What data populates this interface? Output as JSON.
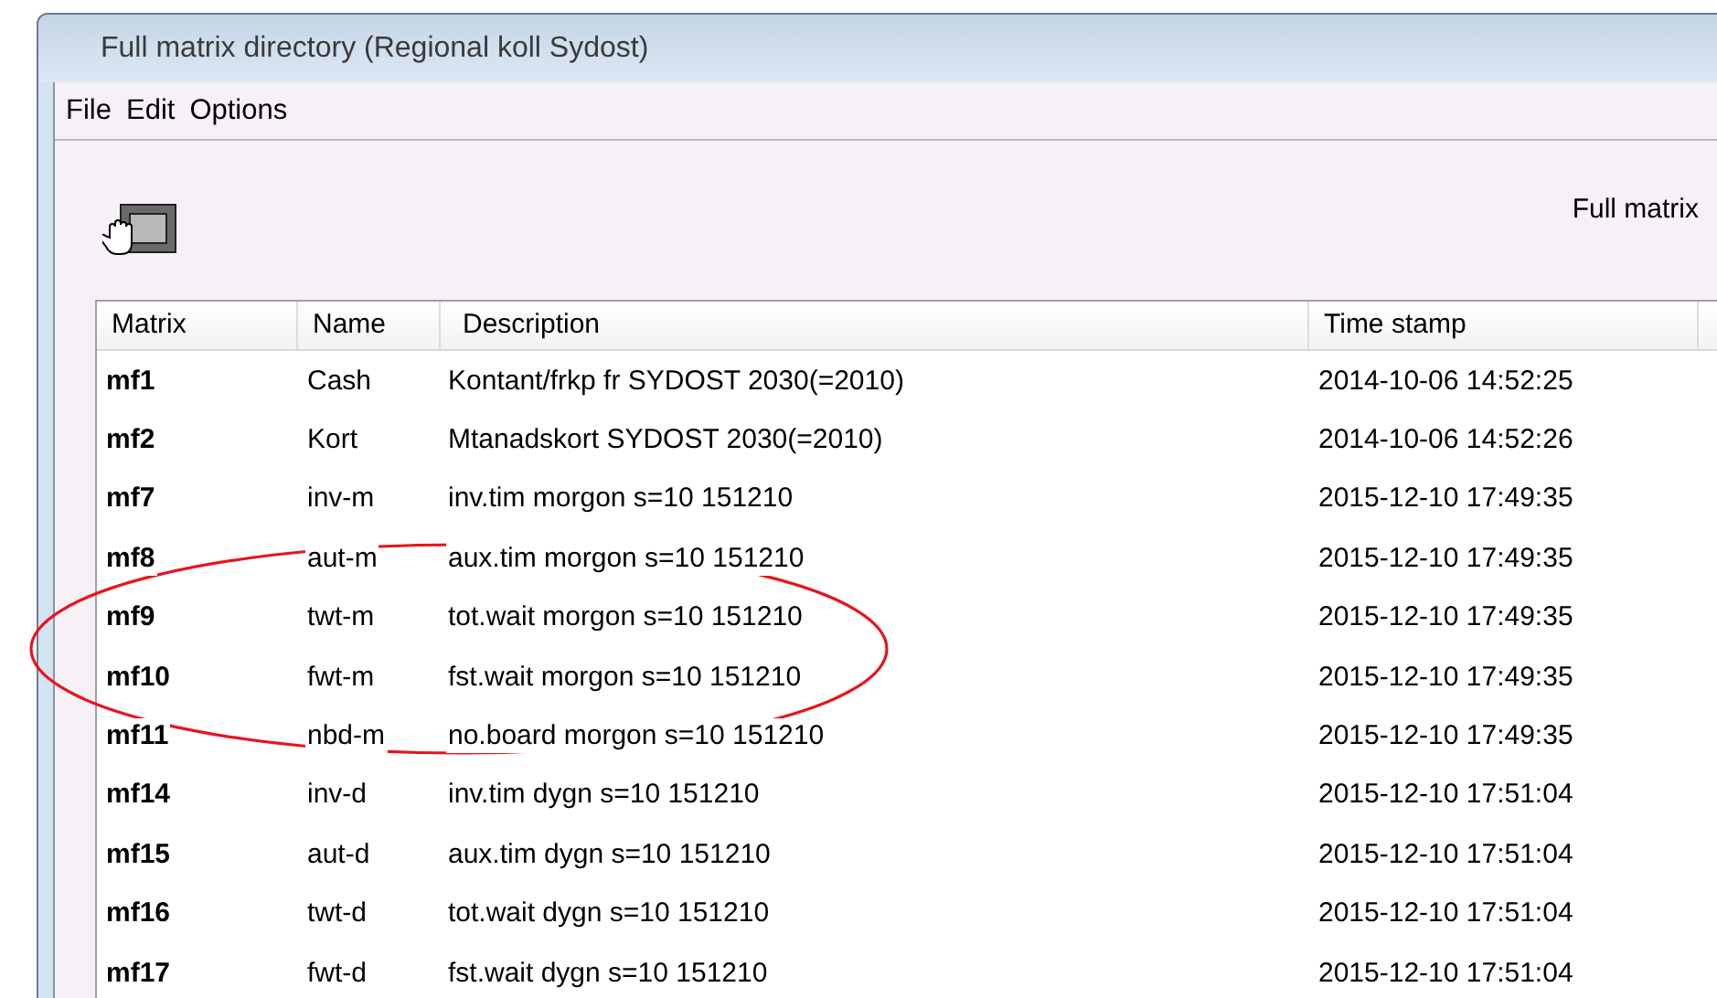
{
  "window": {
    "title": "Full matrix directory (Regional koll Sydost)"
  },
  "menu": [
    "File",
    "Edit",
    "Options"
  ],
  "toolbar": {
    "label": "Full matrix"
  },
  "table": {
    "columns": [
      "Matrix",
      "Name",
      "Description",
      "Time stamp"
    ],
    "rows": [
      {
        "matrix": "mf1",
        "name": "Cash",
        "description": "Kontant/frkp fr SYDOST 2030(=2010)",
        "time_stamp": "2014-10-06 14:52:25"
      },
      {
        "matrix": "mf2",
        "name": "Kort",
        "description": "Mtanadskort SYDOST 2030(=2010)",
        "time_stamp": "2014-10-06 14:52:26"
      },
      {
        "matrix": "mf7",
        "name": "inv-m",
        "description": "inv.tim morgon s=10 151210",
        "time_stamp": "2015-12-10 17:49:35"
      },
      {
        "matrix": "mf8",
        "name": "aut-m",
        "description": "aux.tim morgon s=10 151210",
        "time_stamp": "2015-12-10 17:49:35"
      },
      {
        "matrix": "mf9",
        "name": "twt-m",
        "description": "tot.wait morgon s=10 151210",
        "time_stamp": "2015-12-10 17:49:35"
      },
      {
        "matrix": "mf10",
        "name": "fwt-m",
        "description": "fst.wait morgon s=10 151210",
        "time_stamp": "2015-12-10 17:49:35"
      },
      {
        "matrix": "mf11",
        "name": "nbd-m",
        "description": "no.board morgon s=10 151210",
        "time_stamp": "2015-12-10 17:49:35"
      },
      {
        "matrix": "mf14",
        "name": "inv-d",
        "description": "inv.tim dygn s=10 151210",
        "time_stamp": "2015-12-10 17:51:04"
      },
      {
        "matrix": "mf15",
        "name": "aut-d",
        "description": "aux.tim dygn s=10 151210",
        "time_stamp": "2015-12-10 17:51:04"
      },
      {
        "matrix": "mf16",
        "name": "twt-d",
        "description": "tot.wait dygn s=10 151210",
        "time_stamp": "2015-12-10 17:51:04"
      },
      {
        "matrix": "mf17",
        "name": "fwt-d",
        "description": "fst.wait dygn s=10 151210",
        "time_stamp": "2015-12-10 17:51:04"
      }
    ]
  },
  "annotation": {
    "kind": "ellipse"
  }
}
